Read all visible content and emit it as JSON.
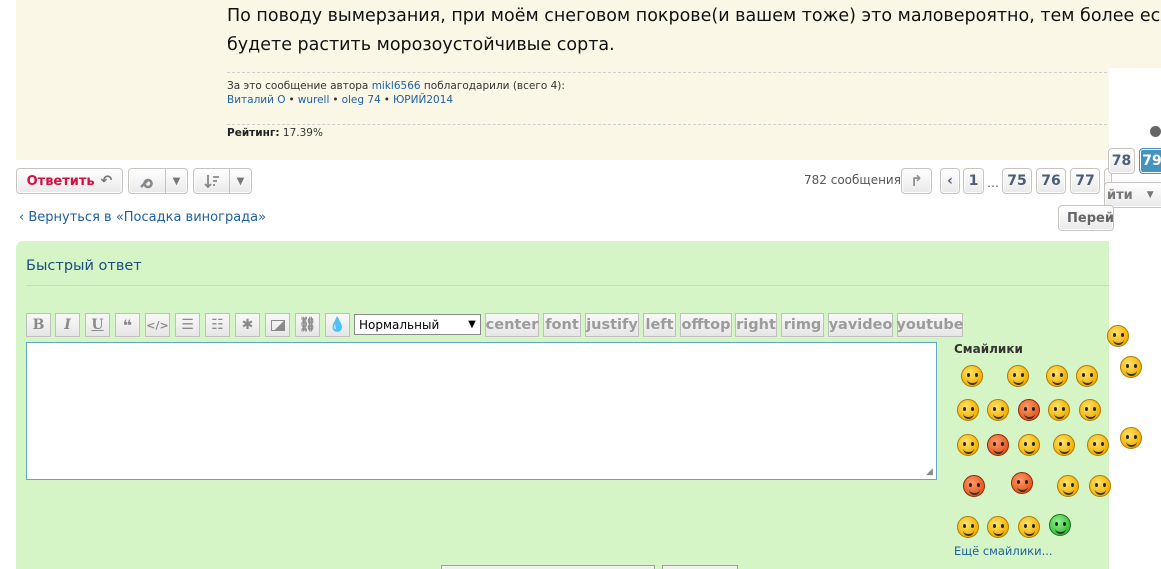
{
  "post": {
    "lines": [
      "По поводу вымерзания, при моём снеговом покрове(и вашем тоже) это маловероятно, тем более если",
      "будете растить морозоустойчивые сорта."
    ],
    "thanks_prefix": "За это сообщение автора",
    "thanks_author": "mikl6566",
    "thanks_suffix": "поблагодарили (всего 4):",
    "thanked_by": [
      "Виталий О",
      "wurell",
      "oleg 74",
      "ЮРИЙ2014"
    ],
    "rating_label": "Рейтинг:",
    "rating_value": "17.39%"
  },
  "actions": {
    "reply_label": "Ответить",
    "message_count": "782 сообщения",
    "pages": [
      "1",
      "75",
      "76",
      "77",
      "78",
      "79"
    ],
    "ellipsis": "…",
    "current_page": "79",
    "jump_label": "йти",
    "back_link": "‹ Вернуться в «Посадка винограда»",
    "next_label": "Перей"
  },
  "quick_reply": {
    "title": "Быстрый ответ",
    "font_size_select": "Нормальный",
    "bbcodes": [
      "center",
      "font",
      "justify",
      "left",
      "offtop",
      "right",
      "rimg",
      "yavideo",
      "youtube"
    ],
    "textarea_value": "",
    "smilies_title": "Смайлики",
    "more_smilies": "Ещё смайлики..."
  },
  "colors": {
    "reply_red": "#d31141",
    "link_blue": "#1e5fa0",
    "quick_reply_bg": "#d6f5c6",
    "post_bg": "#fbf7e7",
    "active_page": "#4692bf"
  }
}
